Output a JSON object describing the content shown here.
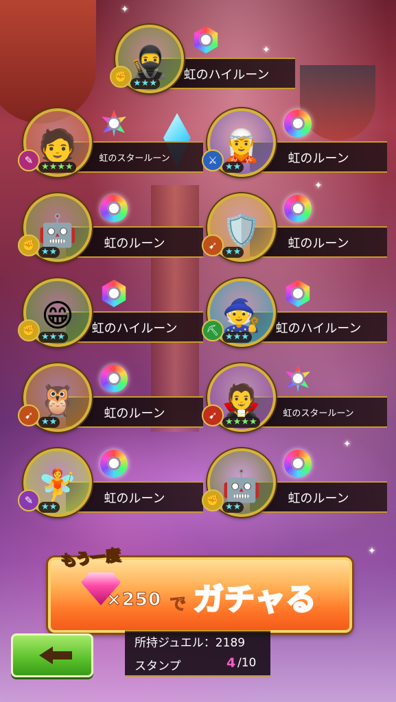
{
  "units": [
    {
      "rune_name": "虹のハイルーン",
      "rune_shape": "hex",
      "stars": 3,
      "star_color": "#63e3f0",
      "type_icon": "fist-icon",
      "type_color": "#d1a51c",
      "face": "🥷",
      "portrait_bg": "#6a8a30"
    },
    {
      "rune_name": "虹のスタールーン",
      "rune_shape": "star",
      "stars": 4,
      "star_color": "#7cf06a",
      "type_icon": "staff-icon",
      "type_color": "#b02a7a",
      "face": "🧑",
      "portrait_bg": "#c25a34"
    },
    {
      "rune_name": "虹のルーン",
      "rune_shape": "drop",
      "stars": 2,
      "star_color": "#63e3f0",
      "type_icon": "sword-icon",
      "type_color": "#2a62c0",
      "face": "🧝",
      "portrait_bg": "#7a5aa8"
    },
    {
      "rune_name": "虹のルーン",
      "rune_shape": "drop",
      "stars": 2,
      "star_color": "#63e3f0",
      "type_icon": "fist-icon",
      "type_color": "#d1a51c",
      "face": "🤖",
      "portrait_bg": "#7a8a30"
    },
    {
      "rune_name": "虹のルーン",
      "rune_shape": "drop",
      "stars": 2,
      "star_color": "#63e3f0",
      "type_icon": "bow-icon",
      "type_color": "#c0501a",
      "face": "🛡️",
      "portrait_bg": "#d09a30"
    },
    {
      "rune_name": "虹のハイルーン",
      "rune_shape": "hex",
      "stars": 3,
      "star_color": "#63e3f0",
      "type_icon": "fist-icon",
      "type_color": "#d1a51c",
      "face": "😁",
      "portrait_bg": "#5a8a2a"
    },
    {
      "rune_name": "虹のハイルーン",
      "rune_shape": "hex",
      "stars": 3,
      "star_color": "#63e3f0",
      "type_icon": "axe-icon",
      "type_color": "#2a9a3a",
      "face": "🧙",
      "portrait_bg": "#3a9ab0"
    },
    {
      "rune_name": "虹のルーン",
      "rune_shape": "drop",
      "stars": 2,
      "star_color": "#63e3f0",
      "type_icon": "bow-icon",
      "type_color": "#c0501a",
      "face": "🦉",
      "portrait_bg": "#a8681a"
    },
    {
      "rune_name": "虹のスタールーン",
      "rune_shape": "star",
      "stars": 4,
      "star_color": "#7cf06a",
      "type_icon": "bow-icon",
      "type_color": "#c0301a",
      "face": "🧛",
      "portrait_bg": "#8a4a9a"
    },
    {
      "rune_name": "虹のルーン",
      "rune_shape": "drop",
      "stars": 2,
      "star_color": "#63e3f0",
      "type_icon": "staff-icon",
      "type_color": "#8a3ab0",
      "face": "🧚",
      "portrait_bg": "#b0c040"
    },
    {
      "rune_name": "虹のルーン",
      "rune_shape": "drop",
      "stars": 2,
      "star_color": "#63e3f0",
      "type_icon": "fist-icon",
      "type_color": "#d1a51c",
      "face": "🤖",
      "portrait_bg": "#6a7a30"
    }
  ],
  "gacha_button": {
    "again_label": "もう一度",
    "cost": "×250",
    "cost_suffix": "で",
    "action_label": "ガチャる",
    "gem_icon": "pink-gem-icon"
  },
  "back_button": {
    "icon": "left-arrow-icon"
  },
  "info": {
    "jewel_label": "所持ジュエル：2189",
    "stamp_label": "スタンプ",
    "stamp_current": "4",
    "stamp_total": "/10"
  },
  "colors": {
    "gold_border": "#c89b2a",
    "stamp_accent": "#ff5ac8",
    "gacha_text": "#ff2a1a",
    "back_green": "#59c02a"
  }
}
